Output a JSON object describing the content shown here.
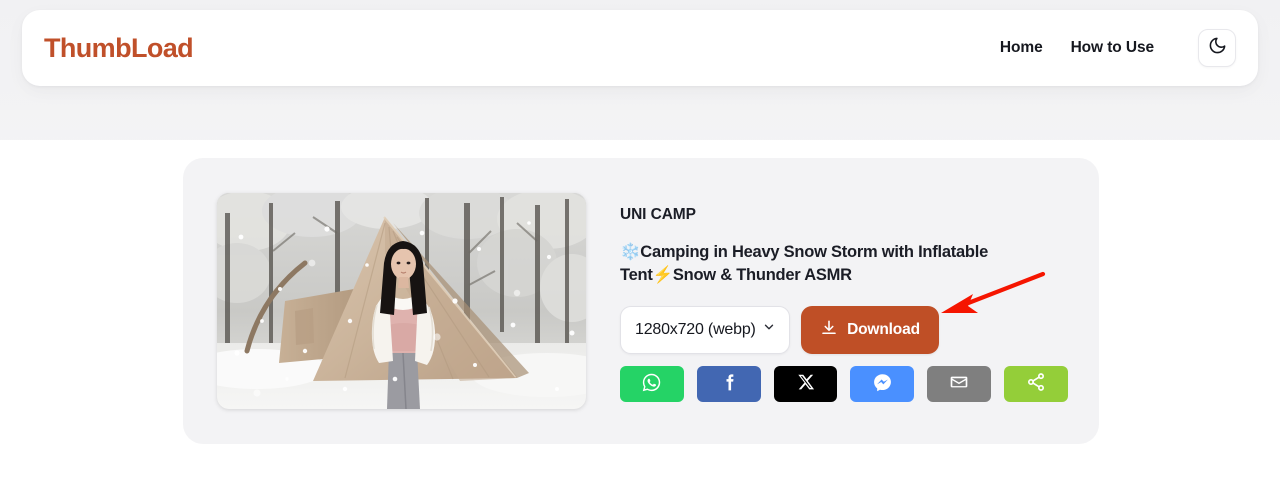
{
  "header": {
    "brand": "ThumbLoad",
    "nav": [
      {
        "label": "Home",
        "name": "nav-link-home"
      },
      {
        "label": "How to Use",
        "name": "nav-link-how-to-use"
      }
    ],
    "theme_toggle_icon": "moon-icon"
  },
  "result": {
    "channel": "UNI CAMP",
    "title": "❄️Camping in Heavy Snow Storm with Inflatable Tent⚡Snow & Thunder ASMR",
    "thumbnail_alt": "woman standing in front of inflatable a-frame tent in snowy forest",
    "format": {
      "selected": "1280x720 (webp)",
      "chevron_icon": "chevron-down-icon"
    },
    "download": {
      "label": "Download",
      "icon": "download-icon",
      "color": "#bf4f26"
    },
    "share": [
      {
        "name": "share-button-whatsapp",
        "label": "WhatsApp",
        "icon": "whatsapp-icon",
        "color": "#25d366"
      },
      {
        "name": "share-button-facebook",
        "label": "Facebook",
        "icon": "facebook-icon",
        "color": "#4267b2"
      },
      {
        "name": "share-button-x",
        "label": "X",
        "icon": "x-twitter-icon",
        "color": "#000000"
      },
      {
        "name": "share-button-messenger",
        "label": "Messenger",
        "icon": "messenger-icon",
        "color": "#4a90ff"
      },
      {
        "name": "share-button-email",
        "label": "Email",
        "icon": "email-icon",
        "color": "#7f7f7f"
      },
      {
        "name": "share-button-more",
        "label": "Share",
        "icon": "share-nodes-icon",
        "color": "#94ce39"
      }
    ]
  },
  "annotation": {
    "arrow_color": "#f51500",
    "arrow_name": "red-pointer-arrow"
  },
  "theme": {
    "brand_color": "#c0502a",
    "card_bg": "#f3f3f5",
    "page_bg": "#ffffff"
  }
}
